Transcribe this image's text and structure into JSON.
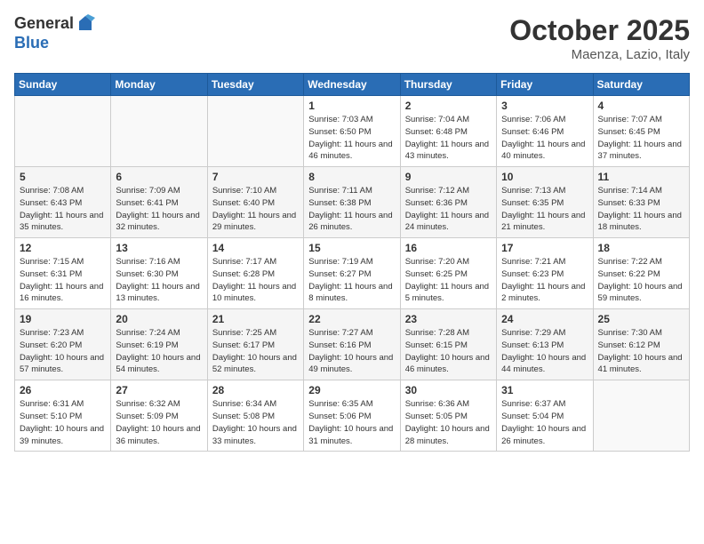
{
  "header": {
    "logo_line1": "General",
    "logo_line2": "Blue",
    "month": "October 2025",
    "location": "Maenza, Lazio, Italy"
  },
  "days_of_week": [
    "Sunday",
    "Monday",
    "Tuesday",
    "Wednesday",
    "Thursday",
    "Friday",
    "Saturday"
  ],
  "weeks": [
    [
      {
        "day": "",
        "info": ""
      },
      {
        "day": "",
        "info": ""
      },
      {
        "day": "",
        "info": ""
      },
      {
        "day": "1",
        "info": "Sunrise: 7:03 AM\nSunset: 6:50 PM\nDaylight: 11 hours and 46 minutes."
      },
      {
        "day": "2",
        "info": "Sunrise: 7:04 AM\nSunset: 6:48 PM\nDaylight: 11 hours and 43 minutes."
      },
      {
        "day": "3",
        "info": "Sunrise: 7:06 AM\nSunset: 6:46 PM\nDaylight: 11 hours and 40 minutes."
      },
      {
        "day": "4",
        "info": "Sunrise: 7:07 AM\nSunset: 6:45 PM\nDaylight: 11 hours and 37 minutes."
      }
    ],
    [
      {
        "day": "5",
        "info": "Sunrise: 7:08 AM\nSunset: 6:43 PM\nDaylight: 11 hours and 35 minutes."
      },
      {
        "day": "6",
        "info": "Sunrise: 7:09 AM\nSunset: 6:41 PM\nDaylight: 11 hours and 32 minutes."
      },
      {
        "day": "7",
        "info": "Sunrise: 7:10 AM\nSunset: 6:40 PM\nDaylight: 11 hours and 29 minutes."
      },
      {
        "day": "8",
        "info": "Sunrise: 7:11 AM\nSunset: 6:38 PM\nDaylight: 11 hours and 26 minutes."
      },
      {
        "day": "9",
        "info": "Sunrise: 7:12 AM\nSunset: 6:36 PM\nDaylight: 11 hours and 24 minutes."
      },
      {
        "day": "10",
        "info": "Sunrise: 7:13 AM\nSunset: 6:35 PM\nDaylight: 11 hours and 21 minutes."
      },
      {
        "day": "11",
        "info": "Sunrise: 7:14 AM\nSunset: 6:33 PM\nDaylight: 11 hours and 18 minutes."
      }
    ],
    [
      {
        "day": "12",
        "info": "Sunrise: 7:15 AM\nSunset: 6:31 PM\nDaylight: 11 hours and 16 minutes."
      },
      {
        "day": "13",
        "info": "Sunrise: 7:16 AM\nSunset: 6:30 PM\nDaylight: 11 hours and 13 minutes."
      },
      {
        "day": "14",
        "info": "Sunrise: 7:17 AM\nSunset: 6:28 PM\nDaylight: 11 hours and 10 minutes."
      },
      {
        "day": "15",
        "info": "Sunrise: 7:19 AM\nSunset: 6:27 PM\nDaylight: 11 hours and 8 minutes."
      },
      {
        "day": "16",
        "info": "Sunrise: 7:20 AM\nSunset: 6:25 PM\nDaylight: 11 hours and 5 minutes."
      },
      {
        "day": "17",
        "info": "Sunrise: 7:21 AM\nSunset: 6:23 PM\nDaylight: 11 hours and 2 minutes."
      },
      {
        "day": "18",
        "info": "Sunrise: 7:22 AM\nSunset: 6:22 PM\nDaylight: 10 hours and 59 minutes."
      }
    ],
    [
      {
        "day": "19",
        "info": "Sunrise: 7:23 AM\nSunset: 6:20 PM\nDaylight: 10 hours and 57 minutes."
      },
      {
        "day": "20",
        "info": "Sunrise: 7:24 AM\nSunset: 6:19 PM\nDaylight: 10 hours and 54 minutes."
      },
      {
        "day": "21",
        "info": "Sunrise: 7:25 AM\nSunset: 6:17 PM\nDaylight: 10 hours and 52 minutes."
      },
      {
        "day": "22",
        "info": "Sunrise: 7:27 AM\nSunset: 6:16 PM\nDaylight: 10 hours and 49 minutes."
      },
      {
        "day": "23",
        "info": "Sunrise: 7:28 AM\nSunset: 6:15 PM\nDaylight: 10 hours and 46 minutes."
      },
      {
        "day": "24",
        "info": "Sunrise: 7:29 AM\nSunset: 6:13 PM\nDaylight: 10 hours and 44 minutes."
      },
      {
        "day": "25",
        "info": "Sunrise: 7:30 AM\nSunset: 6:12 PM\nDaylight: 10 hours and 41 minutes."
      }
    ],
    [
      {
        "day": "26",
        "info": "Sunrise: 6:31 AM\nSunset: 5:10 PM\nDaylight: 10 hours and 39 minutes."
      },
      {
        "day": "27",
        "info": "Sunrise: 6:32 AM\nSunset: 5:09 PM\nDaylight: 10 hours and 36 minutes."
      },
      {
        "day": "28",
        "info": "Sunrise: 6:34 AM\nSunset: 5:08 PM\nDaylight: 10 hours and 33 minutes."
      },
      {
        "day": "29",
        "info": "Sunrise: 6:35 AM\nSunset: 5:06 PM\nDaylight: 10 hours and 31 minutes."
      },
      {
        "day": "30",
        "info": "Sunrise: 6:36 AM\nSunset: 5:05 PM\nDaylight: 10 hours and 28 minutes."
      },
      {
        "day": "31",
        "info": "Sunrise: 6:37 AM\nSunset: 5:04 PM\nDaylight: 10 hours and 26 minutes."
      },
      {
        "day": "",
        "info": ""
      }
    ]
  ]
}
